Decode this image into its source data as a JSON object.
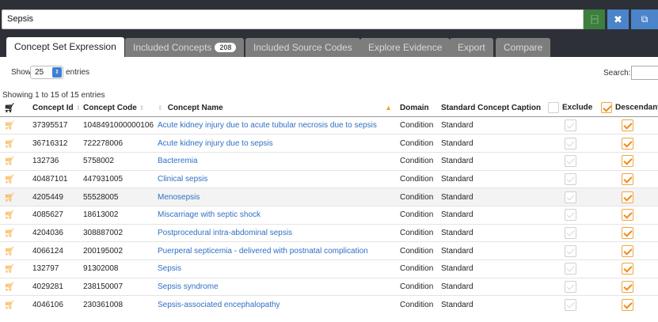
{
  "concept_set": {
    "name": "Sepsis"
  },
  "tabs": [
    {
      "label": "Concept Set Expression",
      "active": true
    },
    {
      "label": "Included Concepts",
      "badge": "208",
      "active": false
    },
    {
      "label": "Included Source Codes",
      "active": false
    },
    {
      "label": "Explore Evidence",
      "active": false
    },
    {
      "label": "Export",
      "active": false
    },
    {
      "label": "Compare",
      "active": false
    }
  ],
  "controls": {
    "show_label": "Show",
    "page_size": "25",
    "entries_label": "entries",
    "search_label": "Search:",
    "search_value": ""
  },
  "info": "Showing 1 to 15 of 15 entries",
  "table": {
    "headers": {
      "concept_id": "Concept Id",
      "concept_code": "Concept Code",
      "concept_name": "Concept Name",
      "domain": "Domain",
      "standard": "Standard Concept Caption",
      "exclude": "Exclude",
      "descendants": "Descendants"
    },
    "rows": [
      {
        "id": "37395517",
        "code": "1048491000000106",
        "name": "Acute kidney injury due to acute tubular necrosis due to sepsis",
        "domain": "Condition",
        "standard": "Standard"
      },
      {
        "id": "36716312",
        "code": "722278006",
        "name": "Acute kidney injury due to sepsis",
        "domain": "Condition",
        "standard": "Standard"
      },
      {
        "id": "132736",
        "code": "5758002",
        "name": "Bacteremia",
        "domain": "Condition",
        "standard": "Standard"
      },
      {
        "id": "40487101",
        "code": "447931005",
        "name": "Clinical sepsis",
        "domain": "Condition",
        "standard": "Standard"
      },
      {
        "id": "4205449",
        "code": "55528005",
        "name": "Menosepsis",
        "domain": "Condition",
        "standard": "Standard"
      },
      {
        "id": "4085627",
        "code": "18613002",
        "name": "Miscarriage with septic shock",
        "domain": "Condition",
        "standard": "Standard"
      },
      {
        "id": "4204036",
        "code": "308887002",
        "name": "Postprocedural intra-abdominal sepsis",
        "domain": "Condition",
        "standard": "Standard"
      },
      {
        "id": "4066124",
        "code": "200195002",
        "name": "Puerperal septicemia - delivered with postnatal complication",
        "domain": "Condition",
        "standard": "Standard"
      },
      {
        "id": "132797",
        "code": "91302008",
        "name": "Sepsis",
        "domain": "Condition",
        "standard": "Standard"
      },
      {
        "id": "4029281",
        "code": "238150007",
        "name": "Sepsis syndrome",
        "domain": "Condition",
        "standard": "Standard"
      },
      {
        "id": "4046106",
        "code": "230361008",
        "name": "Sepsis-associated encephalopathy",
        "domain": "Condition",
        "standard": "Standard"
      }
    ]
  },
  "icons": {
    "save": "save-icon",
    "close": "close-icon",
    "copy": "copy-icon",
    "cart": "shopping-cart-icon",
    "check": "checkbox-icon"
  },
  "colors": {
    "header_bg": "#2d3137",
    "save_green": "#3e7e3f",
    "action_blue": "#4b84c9",
    "link_blue": "#2f6fc4",
    "accent_orange": "#f5a52a"
  }
}
